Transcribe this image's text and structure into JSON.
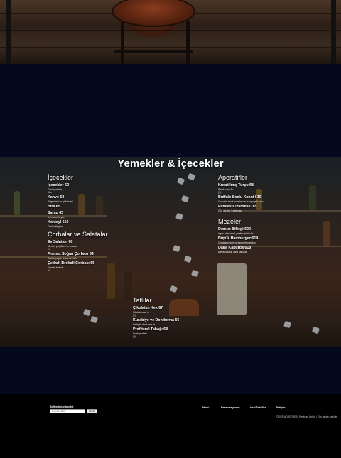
{
  "menu": {
    "title": "Yemekler & İçecekler",
    "columns": {
      "left": [
        {
          "title": "İçecekler",
          "items": [
            {
              "name": "İçecekler 62",
              "desc": "Özel İçecekler",
              "tag": "Bira"
            },
            {
              "name": "Kahve 62",
              "desc": "Bölgemizin en iyi kahvesi",
              "tag": ""
            },
            {
              "name": "Bira 65",
              "desc": "",
              "tag": ""
            },
            {
              "name": "Şarap 65",
              "desc": "Kırmızı ve beyaz",
              "tag": ""
            },
            {
              "name": "Kokteyl 610",
              "desc": "Özel kokteyller",
              "tag": ""
            }
          ]
        },
        {
          "title": "Çorbalar ve Salatalar",
          "items": [
            {
              "name": "Ev Salatası 68",
              "desc": "Mevsim yeşillikleri ve ev sosu",
              "tag": "(V)"
            },
            {
              "name": "Fransız Soğan Çorbası 64",
              "desc": "Gratine peynir ile servis edilir",
              "tag": ""
            },
            {
              "name": "Çedarlı Brokoli Çorbası 65",
              "desc": "Kremalı brokoli",
              "tag": "(V)"
            }
          ]
        }
      ],
      "center": [
        {
          "title": "Tatlılar",
          "items": [
            {
              "name": "Çikolatalı Kek 67",
              "desc": "Çikolata sosu ile",
              "tag": "(V)"
            },
            {
              "name": "Kurabiye ve Dondurma 66",
              "desc": "Vanilyalı dondurma ile",
              "tag": ""
            },
            {
              "name": "Profiterol Tabağı 68",
              "desc": "Sıcak çikolata",
              "tag": "(V)"
            }
          ]
        }
      ],
      "right": [
        {
          "title": "Aperatifler",
          "items": [
            {
              "name": "Kızartılmış Turşu 68",
              "desc": "Ranch sosu ile",
              "tag": "(V)"
            },
            {
              "name": "Buffalo Soslu Kanat 610",
              "desc": "Acı soslu tavuk kanatları ve mavi peynir sosu",
              "tag": ""
            },
            {
              "name": "Patates Kızartması 65",
              "desc": "Çıtır patates kızartması",
              "tag": ""
            }
          ]
        },
        {
          "title": "Mezeler",
          "items": [
            {
              "name": "Domuz Biftegi 622",
              "desc": "Izgara domuz eti, patates püresi ile",
              "tag": ""
            },
            {
              "name": "Büyük Hamburger 614",
              "desc": "Cheddar peyniri ve karamelize soğan",
              "tag": ""
            },
            {
              "name": "Dana Kaburga 618",
              "desc": "Barbekü soslu dana kaburga",
              "tag": ""
            }
          ]
        }
      ]
    }
  },
  "footer": {
    "newsletter_label": "Bülten'imize kaydol",
    "newsletter_placeholder": "E-posta adresi",
    "newsletter_button": "Kaydol",
    "nav": [
      "Menü",
      "Rezervasyonlar",
      "Özel Teklifler",
      "İletişim"
    ],
    "copyright": "©2023 WORDPRESS Restoran Önizle | Tüm hakları saklıdır."
  }
}
